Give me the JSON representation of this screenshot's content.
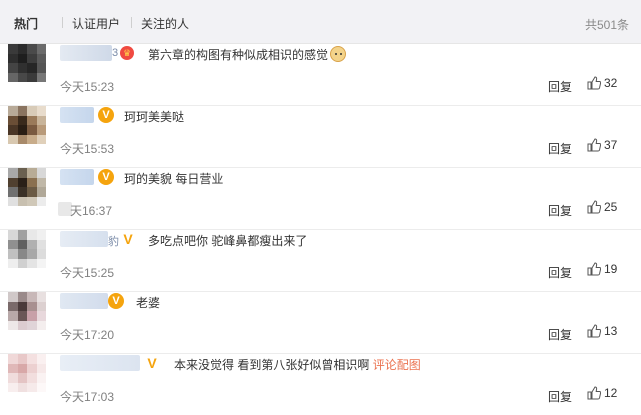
{
  "tabs": [
    {
      "label": "热门",
      "active": true
    },
    {
      "label": "认证用户",
      "active": false
    },
    {
      "label": "关注的人",
      "active": false
    }
  ],
  "total_label": "共501条",
  "colors": {
    "badge": "#f5a40e",
    "link": "#eb7350",
    "username": "#7a8ba8"
  },
  "comments": [
    {
      "name_tail": "3",
      "badge": "crown-icon",
      "text": "第六章的构图有种似成相识的感觉",
      "emoji": "cat-emoji-icon",
      "time": "今天15:23",
      "reply": "回复",
      "likes": "32"
    },
    {
      "name_tail": "",
      "badge": "v-badge-icon",
      "text": "珂珂美美哒",
      "time": "今天15:53",
      "reply": "回复",
      "likes": "37"
    },
    {
      "name_tail": "",
      "badge": "v-badge-icon",
      "text": "珂的美貌 每日营业",
      "time": "天16:37",
      "reply": "回复",
      "likes": "25"
    },
    {
      "name_tail": "豹",
      "badge": "v-badge-icon",
      "text": "多吃点吧你 驼峰鼻都瘦出来了",
      "time": "今天15:25",
      "reply": "回复",
      "likes": "19"
    },
    {
      "name_tail": "",
      "badge": "v-badge-icon",
      "text": "老婆",
      "time": "今天17:20",
      "reply": "回复",
      "likes": "13"
    },
    {
      "name_tail": "",
      "badge": "v-badge-icon",
      "text": "本来没觉得 看到第八张好似曾相识啊",
      "link": "评论配图",
      "time": "今天17:03",
      "reply": "回复",
      "likes": "12"
    }
  ]
}
